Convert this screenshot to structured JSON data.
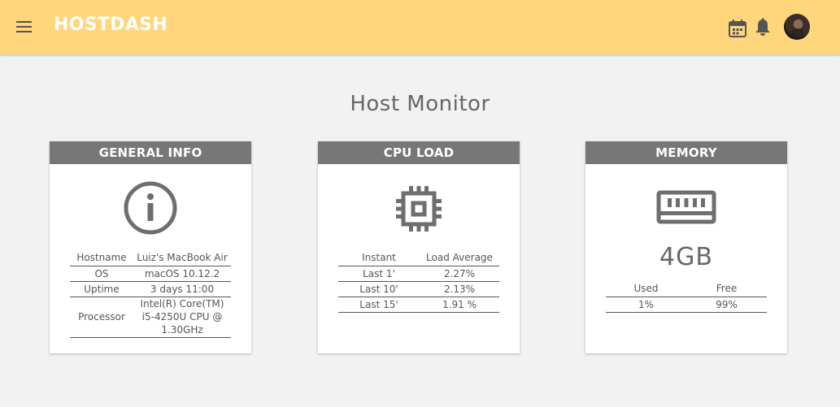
{
  "app": {
    "brand": "HOSTDASH"
  },
  "page": {
    "title": "Host Monitor"
  },
  "colors": {
    "topbar": "#ffd67b",
    "card_header": "#777777",
    "background": "#f2f2f2"
  },
  "icons": {
    "menu": "menu-icon",
    "calendar": "calendar-icon",
    "notifications": "bell-icon",
    "general_info": "info-icon",
    "cpu": "cpu-chip-icon",
    "memory": "memory-icon"
  },
  "general_info": {
    "title": "GENERAL INFO",
    "rows": [
      {
        "label": "Hostname",
        "value": "Luiz's MacBook Air"
      },
      {
        "label": "OS",
        "value": "macOS 10.12.2"
      },
      {
        "label": "Uptime",
        "value": "3 days 11:00"
      },
      {
        "label": "Processor",
        "value": "Intel(R) Core(TM) i5-4250U CPU @ 1.30GHz"
      }
    ]
  },
  "cpu_load": {
    "title": "CPU LOAD",
    "headers": [
      "Instant",
      "Load Average"
    ],
    "rows": [
      {
        "instant": "Last 1'",
        "load": "2.27%"
      },
      {
        "instant": "Last 10'",
        "load": "2.13%"
      },
      {
        "instant": "Last 15'",
        "load": "1.91 %"
      }
    ]
  },
  "memory": {
    "title": "MEMORY",
    "total": "4GB",
    "headers": [
      "Used",
      "Free"
    ],
    "used": "1%",
    "free": "99%"
  }
}
